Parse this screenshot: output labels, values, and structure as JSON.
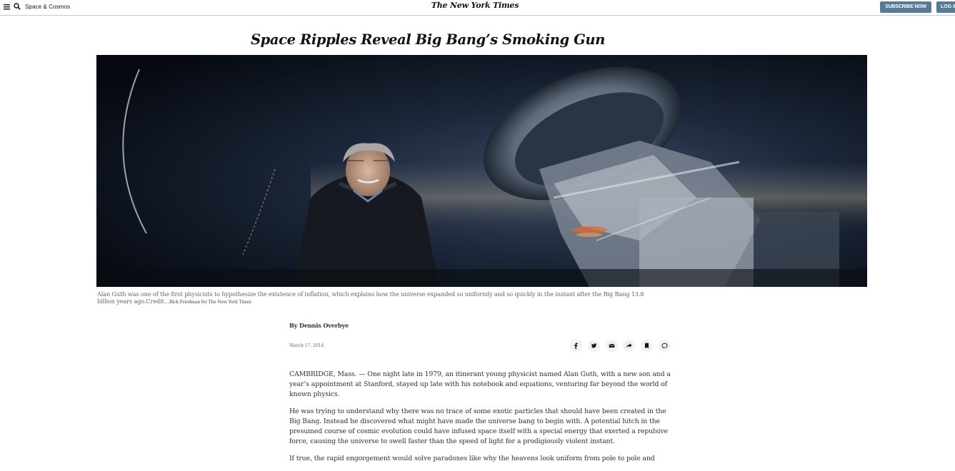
{
  "header": {
    "section_label": "Space & Cosmos",
    "masthead": "The New York Times",
    "subscribe_label": "SUBSCRIBE NOW",
    "login_label": "LOG IN"
  },
  "article": {
    "headline": "Space Ripples Reveal Big Bang’s Smoking Gun",
    "caption_text": "Alan Guth was one of the first physicists to hypothesize the existence of inflation, which explains how the universe expanded so uniformly and so quickly in the instant after the Big Bang 13.8 billion years ago.",
    "credit_label": "Credit...",
    "credit_name": "Rick Friedman for The New York Times",
    "byline": "By Dennis Overbye",
    "date": "March 17, 2014",
    "paragraphs": [
      "CAMBRIDGE, Mass. — One night late in 1979, an itinerant young physicist named Alan Guth, with a new son and a year’s appointment at Stanford, stayed up late with his notebook and equations, venturing far beyond the world of known physics.",
      "He was trying to understand why there was no trace of some exotic particles that should have been created in the Big Bang. Instead he discovered what might have made the universe bang to begin with. A potential hitch in the presumed course of cosmic evolution could have infused space itself with a special energy that exerted a repulsive force, causing the universe to swell faster than the speed of light for a prodigiously violent instant.",
      "If true, the rapid engorgement would solve paradoxes like why the heavens look uniform from pole to pole and"
    ]
  },
  "share_icons": [
    "facebook-icon",
    "twitter-icon",
    "email-icon",
    "share-icon",
    "bookmark-icon",
    "comment-icon"
  ],
  "colors": {
    "subscribe_button": "#567b95",
    "text": "#121212"
  }
}
